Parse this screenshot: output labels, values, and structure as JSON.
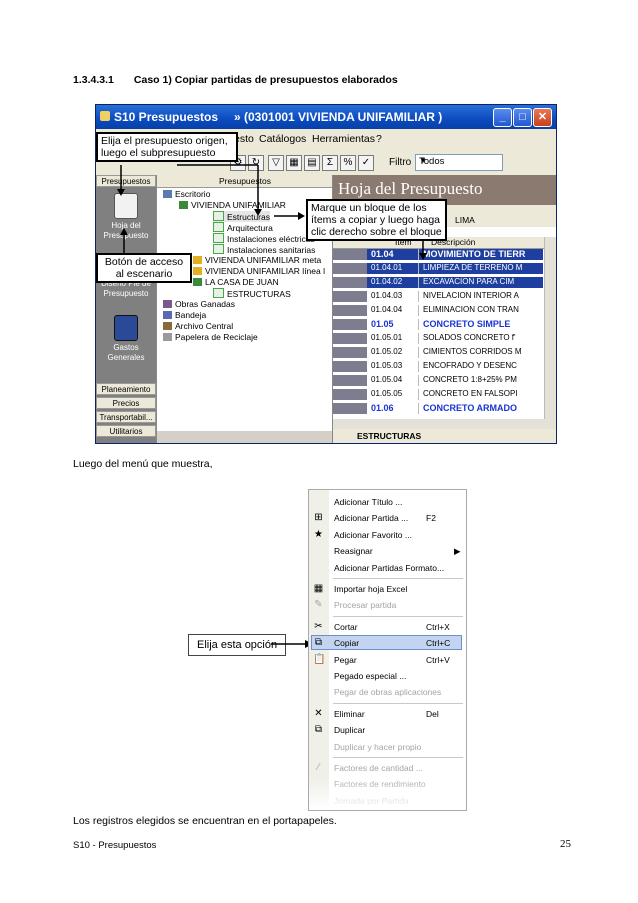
{
  "heading": {
    "number": "1.3.4.3.1",
    "title": "Caso 1) Copiar partidas de presupuestos elaborados"
  },
  "screenshot1": {
    "window_title": "S10 Presupuestos",
    "window_subtitle": "» (0301001 VIVIENDA UNIFAMILIAR )",
    "menu": [
      "esto",
      "Catálogos",
      "Herramientas",
      "?"
    ],
    "filter_label": "Filtro",
    "filter_value": "Todos",
    "left_panel": {
      "header": "Presupuestos",
      "items": [
        "Hoja del Presupuesto",
        "Diseño Pie de Presupuesto",
        "Gastos Generales"
      ],
      "buttons": [
        "Planeamiento",
        "Precios",
        "Transportabil...",
        "Utilitarios"
      ]
    },
    "tree": {
      "header": "Presupuestos",
      "nodes": [
        "Escritorio",
        "VIVIENDA UNIFAMILIAR",
        "Estructuras",
        "Arquitectura",
        "Instalaciones eléctricas",
        "Instalaciones sanitarias",
        "VIVIENDA UNIFAMILIAR meta",
        "VIVIENDA UNIFAMILIAR línea l",
        "LA CASA DE JUAN",
        "ESTRUCTURAS",
        "Obras Ganadas",
        "Bandeja",
        "Archivo Central",
        "Papelera de Reciclaje"
      ]
    },
    "sheet": {
      "banner": "Hoja del Presupuesto",
      "location": "LIMA",
      "col_item": "Item",
      "col_desc": "Descripción",
      "rows": [
        {
          "item": "01.04",
          "desc": "MOVIMIENTO DE TIERR"
        },
        {
          "item": "01.04.01",
          "desc": "LIMPIEZA DE TERRENO M"
        },
        {
          "item": "01.04.02",
          "desc": "EXCAVACION PARA CIM"
        },
        {
          "item": "01.04.03",
          "desc": "NIVELACION INTERIOR A"
        },
        {
          "item": "01.04.04",
          "desc": "ELIMINACION CON TRAN"
        },
        {
          "item": "01.05",
          "desc": "CONCRETO SIMPLE"
        },
        {
          "item": "01.05.01",
          "desc": "SOLADOS CONCRETO f'"
        },
        {
          "item": "01.05.02",
          "desc": "CIMIENTOS CORRIDOS M"
        },
        {
          "item": "01.05.03",
          "desc": "ENCOFRADO Y DESENC"
        },
        {
          "item": "01.05.04",
          "desc": "CONCRETO 1:8+25% PM"
        },
        {
          "item": "01.05.05",
          "desc": "CONCRETO EN FALSOPI"
        },
        {
          "item": "01.06",
          "desc": "CONCRETO ARMADO"
        }
      ],
      "footer": "ESTRUCTURAS"
    },
    "callouts": {
      "elija": [
        "Elija el presupuesto origen,",
        "luego el subpresupuesto"
      ],
      "marque": [
        "Marque un bloque de los",
        "ítems a copiar y luego haga",
        "clic derecho sobre el bloque"
      ],
      "boton": [
        "Botón de acceso",
        "al escenario"
      ]
    }
  },
  "para1": "Luego del menú que muestra,",
  "screenshot2": {
    "callout": "Elija esta opción",
    "menu": [
      {
        "label": "Adicionar Título ...",
        "shortcut": ""
      },
      {
        "label": "Adicionar Partida ...",
        "shortcut": "F2"
      },
      {
        "label": "Adicionar Favorito ...",
        "shortcut": ""
      },
      {
        "label": "Reasignar",
        "shortcut": ""
      },
      {
        "label": "Adicionar Partidas Formato...",
        "shortcut": ""
      },
      {
        "label": "Importar hoja Excel",
        "shortcut": ""
      },
      {
        "label": "Procesar partida",
        "shortcut": ""
      },
      {
        "label": "Cortar",
        "shortcut": "Ctrl+X"
      },
      {
        "label": "Copiar",
        "shortcut": "Ctrl+C"
      },
      {
        "label": "Pegar",
        "shortcut": "Ctrl+V"
      },
      {
        "label": "Pegado especial ...",
        "shortcut": ""
      },
      {
        "label": "Pegar de obras aplicaciones",
        "shortcut": ""
      },
      {
        "label": "Eliminar",
        "shortcut": "Del"
      },
      {
        "label": "Duplicar",
        "shortcut": ""
      },
      {
        "label": "Duplicar y hacer propio",
        "shortcut": ""
      },
      {
        "label": "Factores de cantidad ...",
        "shortcut": ""
      },
      {
        "label": "Factores de rendimiento",
        "shortcut": ""
      },
      {
        "label": "Jornada por Partida",
        "shortcut": ""
      }
    ]
  },
  "para2": "Los registros elegidos se encuentran en el portapapeles.",
  "footer": {
    "left": "S10 - Presupuestos",
    "page": "25"
  }
}
